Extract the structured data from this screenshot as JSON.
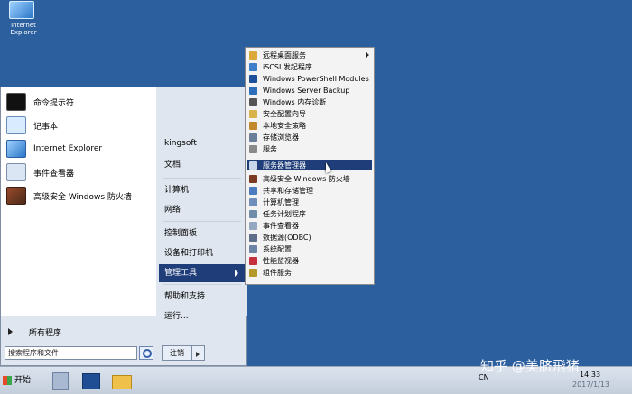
{
  "desktop": {
    "icons": [
      {
        "label": "Internet Explorer"
      }
    ]
  },
  "start_menu": {
    "pinned": [
      {
        "label": "命令提示符",
        "icon": "cmd-icon"
      },
      {
        "label": "记事本",
        "icon": "notepad-icon"
      },
      {
        "label": "Internet Explorer",
        "icon": "internet-explorer-icon"
      },
      {
        "label": "事件查看器",
        "icon": "event-viewer-icon"
      },
      {
        "label": "高级安全 Windows 防火墙",
        "icon": "firewall-icon"
      }
    ],
    "all_programs": "所有程序",
    "search_placeholder": "搜索程序和文件",
    "right_items": [
      {
        "label": "kingsoft"
      },
      {
        "label": "文档"
      },
      {
        "label": "计算机"
      },
      {
        "label": "网络"
      },
      {
        "label": "控制面板"
      },
      {
        "label": "设备和打印机"
      },
      {
        "label": "管理工具"
      },
      {
        "label": "帮助和支持"
      },
      {
        "label": "运行..."
      }
    ],
    "logoff": "注销"
  },
  "admin_tools_menu": {
    "items": [
      {
        "label": "远程桌面服务",
        "icon": "remote-desktop-icon",
        "has_submenu": true
      },
      {
        "label": "iSCSI 发起程序",
        "icon": "iscsi-icon"
      },
      {
        "label": "Windows PowerShell Modules",
        "icon": "powershell-icon"
      },
      {
        "label": "Windows Server Backup",
        "icon": "backup-icon"
      },
      {
        "label": "Windows 内存诊断",
        "icon": "memory-diagnostic-icon"
      },
      {
        "label": "安全配置向导",
        "icon": "security-wizard-icon"
      },
      {
        "label": "本地安全策略",
        "icon": "local-security-policy-icon"
      },
      {
        "label": "存储浏览器",
        "icon": "storage-explorer-icon"
      },
      {
        "label": "服务",
        "icon": "services-icon"
      },
      {
        "label": "服务器管理器",
        "icon": "server-manager-icon",
        "selected": true
      },
      {
        "label": "高级安全 Windows 防火墙",
        "icon": "firewall-icon"
      },
      {
        "label": "共享和存储管理",
        "icon": "share-storage-icon"
      },
      {
        "label": "计算机管理",
        "icon": "computer-management-icon"
      },
      {
        "label": "任务计划程序",
        "icon": "task-scheduler-icon"
      },
      {
        "label": "事件查看器",
        "icon": "event-viewer-icon"
      },
      {
        "label": "数据源(ODBC)",
        "icon": "odbc-icon"
      },
      {
        "label": "系统配置",
        "icon": "system-config-icon"
      },
      {
        "label": "性能监视器",
        "icon": "performance-monitor-icon"
      },
      {
        "label": "组件服务",
        "icon": "component-services-icon"
      }
    ]
  },
  "taskbar": {
    "start_label": "开始",
    "apps": [
      {
        "icon": "server-manager-icon"
      },
      {
        "icon": "powershell-icon"
      },
      {
        "icon": "explorer-folder-icon"
      }
    ],
    "tray": {
      "language": "CN",
      "time": "14:33",
      "date": "2017/1/13"
    }
  },
  "watermark": "知乎 @美脐飛猪",
  "colors": {
    "desktop_bg": "#2b5f9e",
    "selection": "#1f3d78",
    "menu_bg": "#f3f3f3"
  }
}
